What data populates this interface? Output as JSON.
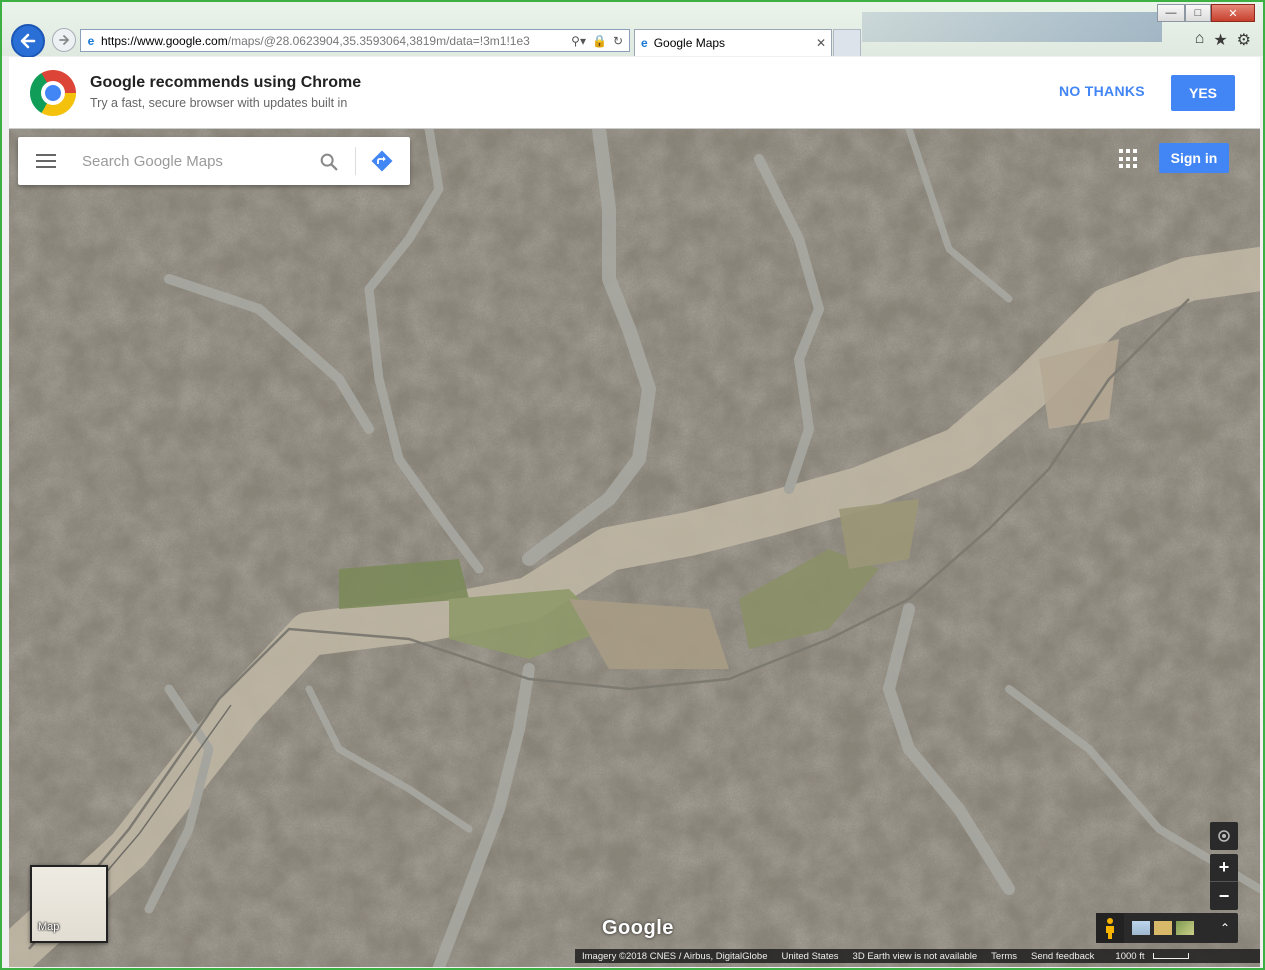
{
  "browser": {
    "url_prefix": "https://www.",
    "url_domain": "google.com",
    "url_rest": "/maps/@28.0623904,35.3593064,3819m/data=!3m1!1e3",
    "tab_title": "Google Maps"
  },
  "banner": {
    "title": "Google recommends using Chrome",
    "subtitle": "Try a fast, secure browser with updates built in",
    "no_thanks": "NO THANKS",
    "yes": "YES"
  },
  "map": {
    "search_placeholder": "Search Google Maps",
    "sign_in": "Sign in",
    "minimap_label": "Map",
    "google_logo": "Google",
    "attribution": {
      "imagery": "Imagery ©2018 CNES / Airbus, DigitalGlobe",
      "region": "United States",
      "earth_view": "3D Earth view is not available",
      "terms": "Terms",
      "feedback": "Send feedback",
      "scale": "1000 ft"
    }
  },
  "colors": {
    "accent": "#4285f4",
    "window_frame": "#3cb043"
  }
}
